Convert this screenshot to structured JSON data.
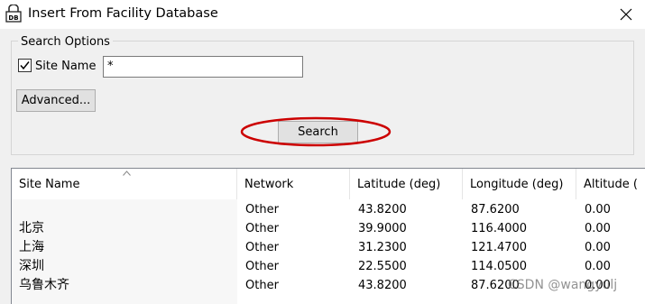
{
  "window": {
    "title": "Insert From Facility Database"
  },
  "search_options": {
    "group_label": "Search Options",
    "site_name_checkbox": {
      "label": "Site Name",
      "checked": true
    },
    "site_name_value": "*",
    "advanced_button": "Advanced...",
    "search_button": "Search",
    "highlight_color": "#cc0000"
  },
  "table": {
    "columns": [
      "Site Name",
      "Network",
      "Latitude (deg)",
      "Longitude (deg)",
      "Altitude ("
    ],
    "rows": [
      {
        "site": "",
        "network": "Other",
        "lat": "43.8200",
        "lon": "87.6200",
        "alt": "0.00"
      },
      {
        "site": "北京",
        "network": "Other",
        "lat": "39.9000",
        "lon": "116.4000",
        "alt": "0.00"
      },
      {
        "site": "上海",
        "network": "Other",
        "lat": "31.2300",
        "lon": "121.4700",
        "alt": "0.00"
      },
      {
        "site": "深圳",
        "network": "Other",
        "lat": "22.5500",
        "lon": "114.0500",
        "alt": "0.00"
      },
      {
        "site": "乌鲁木齐",
        "network": "Other",
        "lat": "43.8200",
        "lon": "87.6200",
        "alt": "0.00"
      }
    ]
  },
  "watermark": "CSDN @wangyulj"
}
